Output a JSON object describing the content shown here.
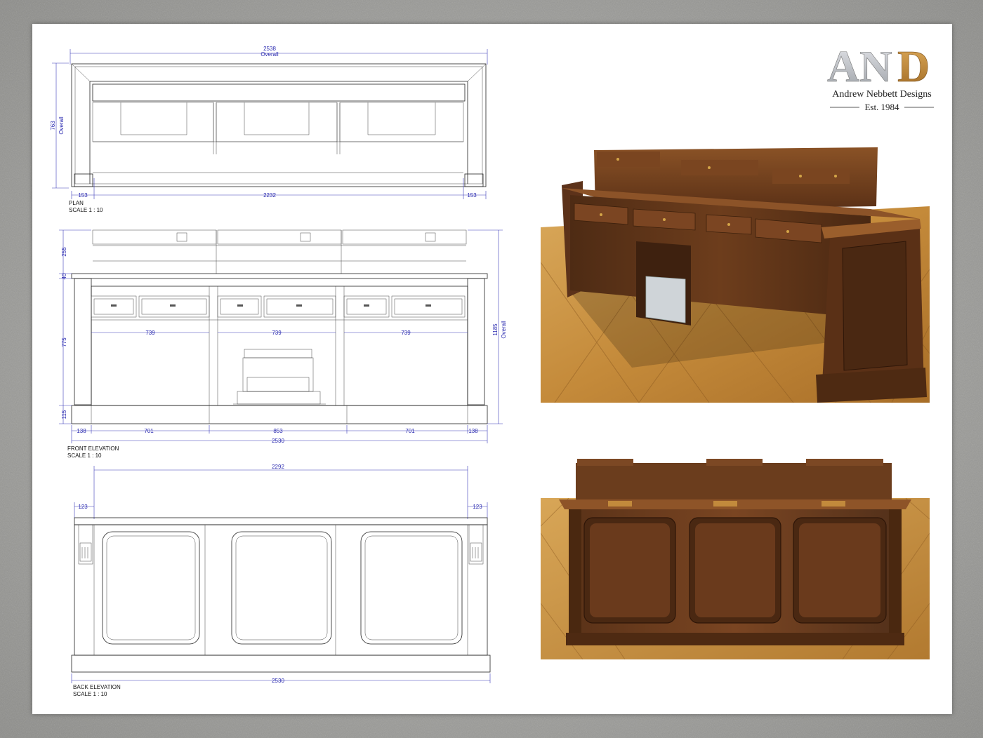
{
  "brand": {
    "monogram": "AND",
    "company": "Andrew Nebbett Designs",
    "established": "Est. 1984",
    "gold": "#c28a3c",
    "silver": "#c9cbcf"
  },
  "dimension_color": "#2b2bb0",
  "plan": {
    "title": "PLAN",
    "scale": "SCALE 1 : 10",
    "overall_width": "2538",
    "overall_word": "Overall",
    "depth": "763",
    "depth_word": "Overall",
    "left_end": "153",
    "middle": "2232",
    "right_end": "153"
  },
  "front": {
    "title": "FRONT ELEVATION",
    "scale": "SCALE 1 : 10",
    "upper_height": "255",
    "top_thickness": "40",
    "body_height": "775",
    "plinth_height": "115",
    "overall_height": "1185",
    "overall_word": "Overall",
    "bay1": "739",
    "bay2": "739",
    "bay3": "739",
    "left_end": "138",
    "left_bay": "701",
    "center_bay": "853",
    "right_bay": "701",
    "right_end": "138",
    "overall_width": "2530"
  },
  "back": {
    "title": "BACK ELEVATION",
    "scale": "SCALE 1 : 10",
    "upper_width": "2292",
    "left_overhang": "123",
    "right_overhang": "123",
    "overall_width": "2530"
  }
}
